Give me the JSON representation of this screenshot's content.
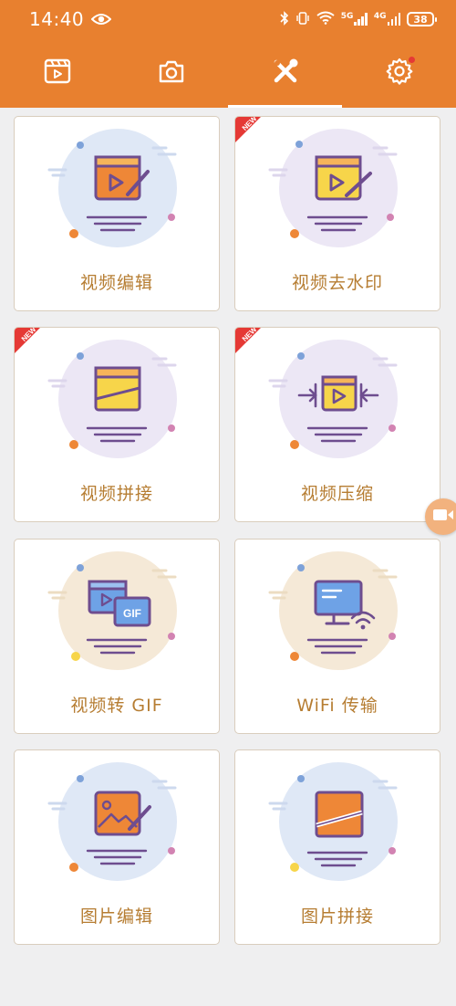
{
  "status_bar": {
    "time": "14:40",
    "network_5g": "5G",
    "network_4g": "4G",
    "battery": "38"
  },
  "tabs": [
    {
      "icon": "video-clip-icon",
      "active": false
    },
    {
      "icon": "camera-icon",
      "active": false
    },
    {
      "icon": "tools-icon",
      "active": true
    },
    {
      "icon": "gear-icon",
      "active": false,
      "badge": true
    }
  ],
  "colors": {
    "brand": "#e8802f",
    "label": "#b67d32",
    "ribbon": "#e53935",
    "circle_blue": "#dfe8f6",
    "circle_purple": "#ece7f5",
    "circle_beige": "#f5e9d7"
  },
  "ribbon_text": "NEW",
  "cards": [
    {
      "label": "视频编辑",
      "icon": "video-edit-icon",
      "new": false
    },
    {
      "label": "视频去水印",
      "icon": "video-watermark-remove-icon",
      "new": true
    },
    {
      "label": "视频拼接",
      "icon": "video-merge-icon",
      "new": true
    },
    {
      "label": "视频压缩",
      "icon": "video-compress-icon",
      "new": true
    },
    {
      "label": "视频转 GIF",
      "icon": "video-to-gif-icon",
      "new": false
    },
    {
      "label": "WiFi 传输",
      "icon": "wifi-transfer-icon",
      "new": false
    },
    {
      "label": "图片编辑",
      "icon": "image-edit-icon",
      "new": false
    },
    {
      "label": "图片拼接",
      "icon": "image-merge-icon",
      "new": false
    }
  ]
}
